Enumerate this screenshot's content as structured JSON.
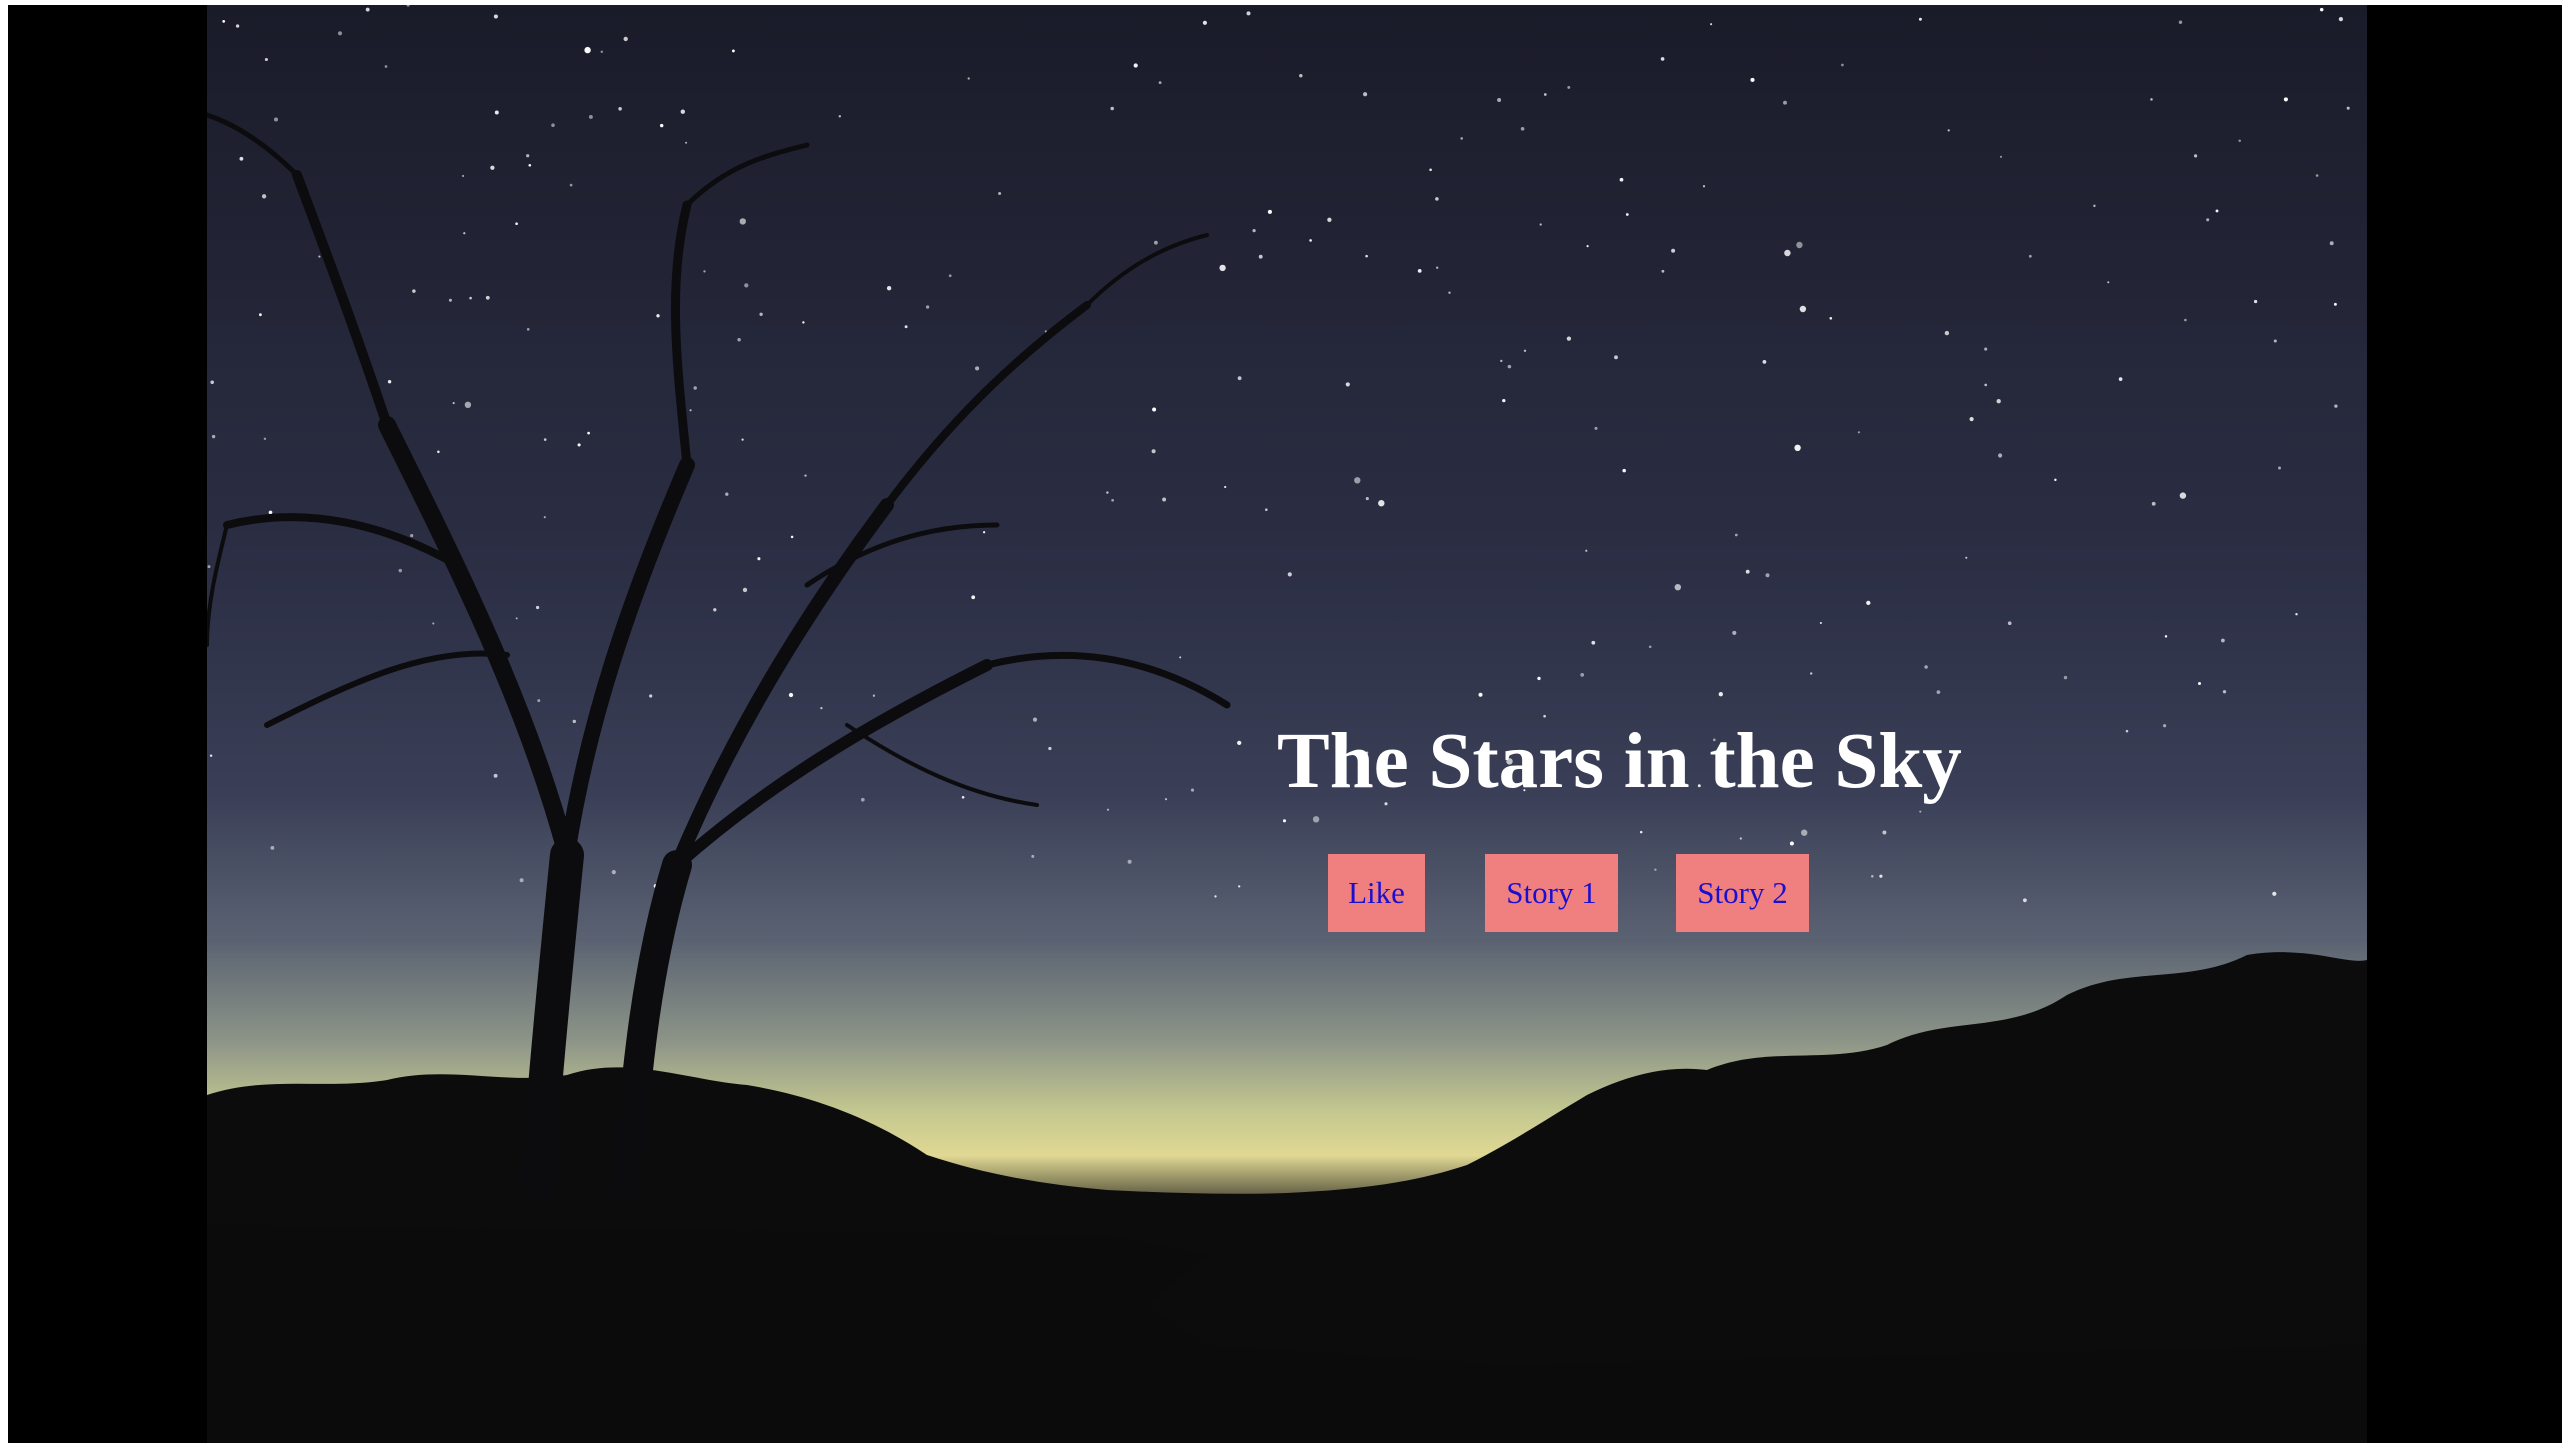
{
  "page": {
    "title": "The Stars in the Sky"
  },
  "buttons": {
    "like_label": "Like",
    "story1_label": "Story 1",
    "story2_label": "Story 2"
  },
  "colors": {
    "button_background": "#f08080",
    "button_text": "#1a0fd0",
    "title_text": "#ffffff",
    "letterbox": "#000000"
  }
}
